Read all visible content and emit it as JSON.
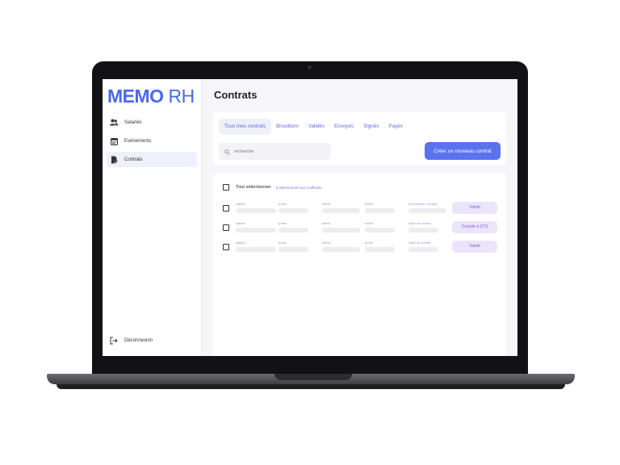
{
  "app": {
    "logo_bold": "MEMO",
    "logo_light": " RH"
  },
  "sidebar": {
    "items": [
      {
        "label": "Salariés",
        "icon": "people-icon"
      },
      {
        "label": "Evénements",
        "icon": "calendar-icon"
      },
      {
        "label": "Contrats",
        "icon": "contract-icon",
        "active": true
      }
    ],
    "logout_label": "Déconnexion"
  },
  "main": {
    "title": "Contrats",
    "tabs": [
      {
        "label": "Tous mes contrats",
        "active": true
      },
      {
        "label": "Brouillons"
      },
      {
        "label": "Validés"
      },
      {
        "label": "Envoyés"
      },
      {
        "label": "Signés"
      },
      {
        "label": "Payés"
      }
    ],
    "search": {
      "placeholder": "recherche",
      "value": ""
    },
    "new_contract_label": "Créer un nouveau contrat",
    "list": {
      "select_all_label": "Tout sélectionner",
      "selection_info": "0 sélectionnés sur 3 affichés",
      "rows": [
        {
          "salarie": "salarié",
          "poste": "poste",
          "debut": "début",
          "duree": "durée",
          "motif": "évènement / contrat",
          "status": "Validé"
        },
        {
          "salarie": "salarié",
          "poste": "poste",
          "debut": "début",
          "duree": "durée",
          "motif": "objet du contrat",
          "status": "Compté à DTS"
        },
        {
          "salarie": "salarié",
          "poste": "poste",
          "debut": "début",
          "duree": "durée",
          "motif": "objet du contrat",
          "status": "Validé"
        }
      ]
    }
  },
  "colors": {
    "accent": "#5b72ee",
    "logo": "#4a68e8",
    "status_bg": "#ebe4fb",
    "status_text": "#7a6bd8"
  }
}
